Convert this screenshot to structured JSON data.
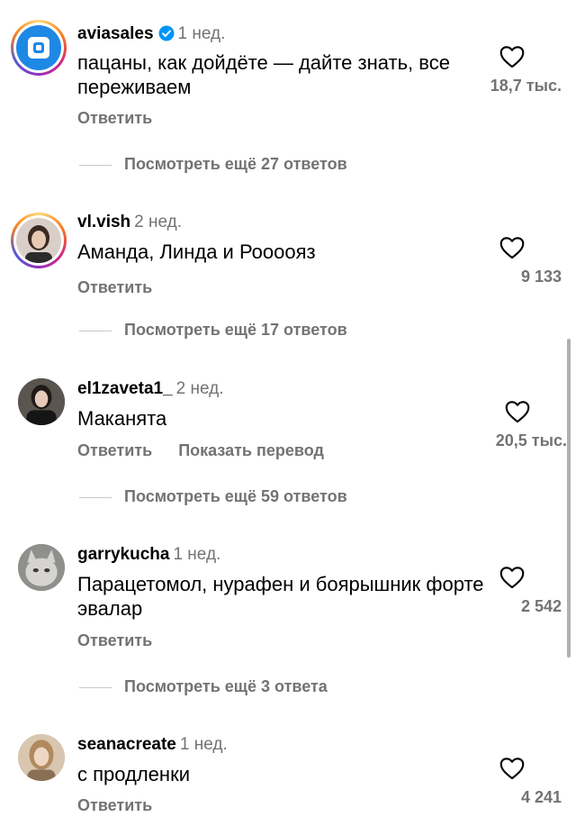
{
  "comments": [
    {
      "username": "aviasales",
      "time": "1 нед.",
      "verified": true,
      "text": "пацаны, как дойдёте — дайте знать, все переживаем",
      "reply_label": "Ответить",
      "likes": "18,7 тыс.",
      "more_replies": "Посмотреть ещё 27 ответов"
    },
    {
      "username": "vl.vish",
      "time": "2 нед.",
      "text": "Аманда, Линда и Роооояз",
      "reply_label": "Ответить",
      "likes": "9 133",
      "more_replies": "Посмотреть ещё 17 ответов"
    },
    {
      "username": "el1zaveta1_",
      "time": "2 нед.",
      "text": "Маканята",
      "reply_label": "Ответить",
      "translate_label": "Показать перевод",
      "likes": "20,5 тыс.",
      "more_replies": "Посмотреть ещё 59 ответов"
    },
    {
      "username": "garrykucha",
      "time": "1 нед.",
      "text": "Парацетомол, нурафен и боярышник форте эвалар",
      "reply_label": "Ответить",
      "likes": "2 542",
      "more_replies": "Посмотреть ещё 3 ответа"
    },
    {
      "username": "seanacreate",
      "time": "1 нед.",
      "text": "с продленки",
      "reply_label": "Ответить",
      "likes": "4 241"
    }
  ],
  "icons": {
    "like": "heart-outline-icon",
    "verified": "verified-badge-icon"
  },
  "colors": {
    "secondary_text": "#737373",
    "verified_blue": "#0095f6"
  }
}
